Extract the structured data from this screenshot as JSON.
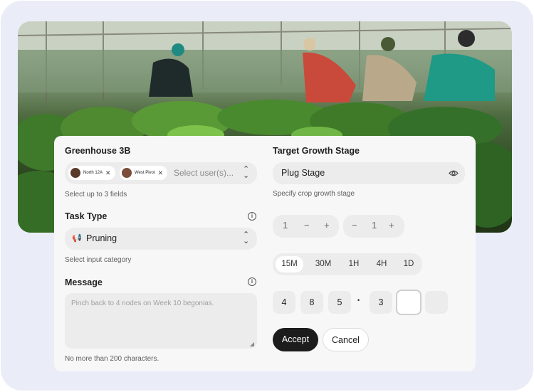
{
  "left": {
    "greenhouse": {
      "label": "Greenhouse 3B",
      "chips": [
        {
          "label": "North 12A",
          "avatar_color": "#5a3a2a"
        },
        {
          "label": "West Pivot",
          "avatar_color": "#7a4e3a"
        }
      ],
      "placeholder": "Select user(s)...",
      "hint": "Select up to 3 fields"
    },
    "task_type": {
      "label": "Task Type",
      "value": "Pruning",
      "hint": "Select input category"
    },
    "message": {
      "label": "Message",
      "placeholder": "Pinch back to 4 nodes on Week 10 begonias.",
      "hint": "No more than 200 characters."
    }
  },
  "right": {
    "growth_stage": {
      "label": "Target Growth Stage",
      "value": "Plug Stage",
      "hint": "Specify crop growth stage"
    },
    "steppers": [
      {
        "value": "1",
        "minus": "−",
        "plus": "+"
      },
      {
        "value": "1",
        "minus": "−",
        "plus": "+"
      }
    ],
    "intervals": {
      "options": [
        "15M",
        "30M",
        "1H",
        "4H",
        "1D"
      ],
      "selected": "15M"
    },
    "code": {
      "digits": [
        "4",
        "8",
        "5",
        "3",
        "",
        ""
      ],
      "separator": "•"
    },
    "actions": {
      "accept": "Accept",
      "cancel": "Cancel"
    }
  },
  "colors": {
    "frame": "#eaedf7",
    "card": "#f7f7f7",
    "field": "#ececec",
    "primary": "#1c1c1c"
  },
  "icons": [
    "chevron-up-down-icon",
    "megaphone-icon",
    "info-icon",
    "eye-icon",
    "close-icon",
    "resize-grip-icon"
  ]
}
